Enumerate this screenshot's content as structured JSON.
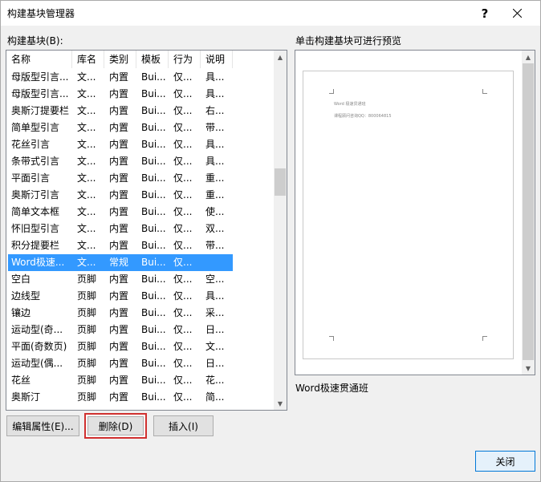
{
  "window": {
    "title": "构建基块管理器",
    "help_label": "?"
  },
  "left_label": "构建基块(B):",
  "right_label": "单击构建基块可进行预览",
  "columns": [
    "名称",
    "库名",
    "类别",
    "模板",
    "行为",
    "说明"
  ],
  "rows": [
    [
      "母版型引言...",
      "文...",
      "内置",
      "Bui...",
      "仅...",
      "具..."
    ],
    [
      "母版型引言...",
      "文...",
      "内置",
      "Bui...",
      "仅...",
      "具..."
    ],
    [
      "奥斯汀提要栏",
      "文...",
      "内置",
      "Bui...",
      "仅...",
      "右..."
    ],
    [
      "简单型引言",
      "文...",
      "内置",
      "Bui...",
      "仅...",
      "带..."
    ],
    [
      "花丝引言",
      "文...",
      "内置",
      "Bui...",
      "仅...",
      "具..."
    ],
    [
      "条带式引言",
      "文...",
      "内置",
      "Bui...",
      "仅...",
      "具..."
    ],
    [
      "平面引言",
      "文...",
      "内置",
      "Bui...",
      "仅...",
      "重..."
    ],
    [
      "奥斯汀引言",
      "文...",
      "内置",
      "Bui...",
      "仅...",
      "重..."
    ],
    [
      " 简单文本框",
      "文...",
      "内置",
      "Bui...",
      "仅...",
      "使..."
    ],
    [
      "怀旧型引言",
      "文...",
      "内置",
      "Bui...",
      "仅...",
      "双..."
    ],
    [
      "积分提要栏",
      "文...",
      "内置",
      "Bui...",
      "仅...",
      "带..."
    ],
    [
      "Word极速...",
      "文...",
      "常规",
      "Bui...",
      "仅...",
      ""
    ],
    [
      " 空白",
      "页脚",
      "内置",
      "Bui...",
      "仅...",
      "空..."
    ],
    [
      "边线型",
      "页脚",
      "内置",
      "Bui...",
      "仅...",
      "具..."
    ],
    [
      "镶边",
      "页脚",
      "内置",
      "Bui...",
      "仅...",
      "采..."
    ],
    [
      "运动型(奇...",
      "页脚",
      "内置",
      "Bui...",
      "仅...",
      "日..."
    ],
    [
      "平面(奇数页)",
      "页脚",
      "内置",
      "Bui...",
      "仅...",
      "文..."
    ],
    [
      "运动型(偶...",
      "页脚",
      "内置",
      "Bui...",
      "仅...",
      "日..."
    ],
    [
      "花丝",
      "页脚",
      "内置",
      "Bui...",
      "仅...",
      "花..."
    ],
    [
      "奥斯汀",
      "页脚",
      "内置",
      "Bui...",
      "仅...",
      "简..."
    ]
  ],
  "selected_row": 11,
  "preview": {
    "line1": "Word 极速贯通班",
    "line2": "课程顾问咨询QQ：800064815",
    "entry_name": "Word极速贯通班"
  },
  "buttons": {
    "edit": "编辑属性(E)...",
    "delete": "删除(D)",
    "insert": "插入(I)",
    "close": "关闭"
  },
  "colors": {
    "selection": "#3399ff",
    "highlight_border": "#d0302f"
  }
}
